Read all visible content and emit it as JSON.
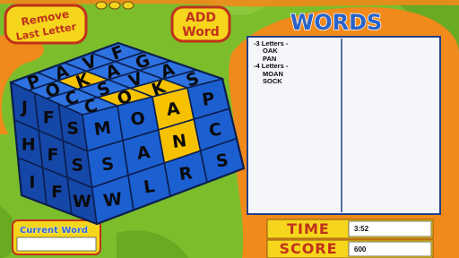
{
  "buttons": {
    "remove_line1": "Remove",
    "remove_line2": "Last Letter",
    "add_line1": "ADD",
    "add_line2": "Word"
  },
  "words_panel": {
    "title": "WORDS",
    "lines": [
      {
        "text": "-3 Letters -",
        "kind": "heading"
      },
      {
        "text": "OAK",
        "kind": "word"
      },
      {
        "text": "PAN",
        "kind": "word"
      },
      {
        "text": "-4 Letters -",
        "kind": "heading"
      },
      {
        "text": "MOAN",
        "kind": "word"
      },
      {
        "text": "SOCK",
        "kind": "word"
      }
    ]
  },
  "current_word": {
    "label": "Current Word",
    "value": ""
  },
  "stats": {
    "time_label": "TIME",
    "time_value": "3:52",
    "score_label": "SCORE",
    "score_value": "600"
  },
  "cube": {
    "colors": {
      "tile": "#1c5fd1",
      "tile_dark": "#1547a8",
      "tile_light": "#2d72e0",
      "selected": "#f6c200",
      "background_green": "#7cbd2c",
      "frame_orange": "#f08a1a"
    },
    "top": [
      [
        "P",
        "A",
        "V"
      ],
      [
        "F",
        "O",
        "K",
        "A"
      ],
      [
        "G",
        "C",
        "S",
        "V"
      ],
      [
        "A",
        "C",
        "O",
        "K"
      ]
    ],
    "top_labeled": [
      {
        "letter": "P",
        "selected": false
      },
      {
        "letter": "A",
        "selected": false
      },
      {
        "letter": "V",
        "selected": false
      },
      {
        "letter": "F",
        "selected": false
      },
      {
        "letter": "O",
        "selected": false
      },
      {
        "letter": "K",
        "selected": true
      },
      {
        "letter": "A",
        "selected": false
      },
      {
        "letter": "G",
        "selected": false
      },
      {
        "letter": "C",
        "selected": false
      },
      {
        "letter": "S",
        "selected": false
      },
      {
        "letter": "V",
        "selected": false
      },
      {
        "letter": "A",
        "selected": false
      },
      {
        "letter": "C",
        "selected": false
      },
      {
        "letter": "O",
        "selected": true
      },
      {
        "letter": "K",
        "selected": true
      },
      {
        "letter": "S",
        "selected": false
      }
    ],
    "left": [
      [
        "J",
        "F",
        "S"
      ],
      [
        "H",
        "F",
        "S"
      ],
      [
        "I",
        "F",
        "W"
      ]
    ],
    "front": [
      [
        "M",
        "O",
        "A",
        "P"
      ],
      [
        "S",
        "A",
        "N",
        "C"
      ],
      [
        "W",
        "L",
        "R",
        "S"
      ]
    ],
    "front_selected": [
      [
        false,
        false,
        true,
        false
      ],
      [
        false,
        false,
        true,
        false
      ],
      [
        false,
        false,
        false,
        false
      ]
    ]
  }
}
